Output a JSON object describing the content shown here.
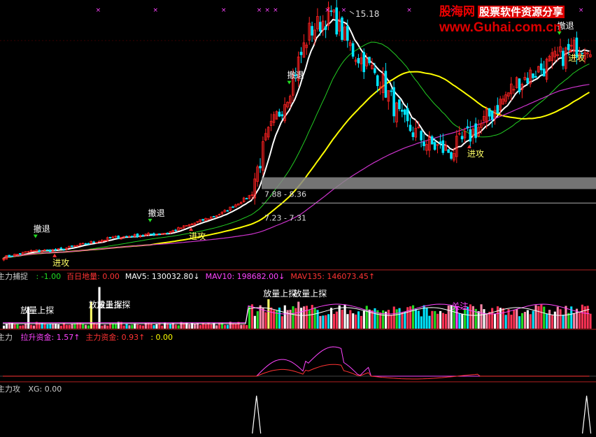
{
  "watermark": {
    "brand": "股海网",
    "slogan": "股票软件资源分享",
    "url": "www.Guhai.com.cn"
  },
  "main_pane": {
    "peak_label": "15.18",
    "range_boxes": [
      {
        "label": "7.88 - 8.36",
        "low": 7.88,
        "high": 8.36
      },
      {
        "label": "7.23 - 7.31",
        "low": 7.23,
        "high": 7.31
      }
    ],
    "signals": [
      {
        "text": "撤退",
        "index": 12
      },
      {
        "text": "进攻",
        "index": 19
      },
      {
        "text": "撤退",
        "index": 54
      },
      {
        "text": "进攻",
        "index": 69
      },
      {
        "text": "撤退",
        "index": 105
      },
      {
        "text": "进攻",
        "index": 171
      },
      {
        "text": "撤退",
        "index": 204
      },
      {
        "text": "进攻",
        "index": 208
      }
    ]
  },
  "volume_pane": {
    "title": "主力捕捉",
    "readouts": [
      {
        "text": ": -1.00",
        "color": "#22dd22"
      },
      {
        "text": "百日地量: 0.00",
        "color": "#ff3333"
      },
      {
        "text": "MAV5: 130032.80",
        "color": "#ffffff"
      },
      {
        "text": "MAV10: 198682.00",
        "color": "#ff44ff"
      },
      {
        "text": "MAV135: 146073.45",
        "color": "#ff3333"
      }
    ],
    "arrows": [
      "↓",
      "↓",
      "↑"
    ],
    "annotations": [
      {
        "text": "放量上探",
        "index": 8
      },
      {
        "text": "放量上探",
        "index": 33
      },
      {
        "text": "放量上探",
        "index": 36
      },
      {
        "text": "放量上探",
        "index": 97
      },
      {
        "text": "放量上探",
        "index": 108
      },
      {
        "text": "关注",
        "index": 166
      }
    ]
  },
  "fund_pane": {
    "title": "主力",
    "readouts": [
      {
        "text": "拉升资金: 1.57",
        "color": "#ff44ff",
        "arrow": "↑"
      },
      {
        "text": "主力资金: 0.93",
        "color": "#ff3333",
        "arrow": "↑"
      },
      {
        "text": ": 0.00",
        "color": "#ffff00",
        "arrow": ""
      }
    ]
  },
  "attack_pane": {
    "title": "主力攻",
    "readouts": [
      {
        "text": "XG: 0.00",
        "color": "#cccccc"
      }
    ]
  },
  "chart_data": {
    "type": "candlestick",
    "series_colors": {
      "up_candle": "#ff2222",
      "down_candle": "#00e5ff",
      "ma_white": "#ffffff",
      "ma_green": "#22cc22",
      "ma_yellow": "#ffff00",
      "ma_magenta": "#cc33cc"
    },
    "price_anchors": [
      [
        0,
        5.1
      ],
      [
        10,
        5.35
      ],
      [
        20,
        5.4
      ],
      [
        40,
        5.9
      ],
      [
        60,
        6.1
      ],
      [
        80,
        6.9
      ],
      [
        90,
        7.6
      ],
      [
        96,
        9.8
      ],
      [
        104,
        11.8
      ],
      [
        112,
        14.3
      ],
      [
        120,
        15.0
      ],
      [
        128,
        13.5
      ],
      [
        138,
        12.4
      ],
      [
        146,
        10.6
      ],
      [
        156,
        9.7
      ],
      [
        164,
        9.4
      ],
      [
        176,
        10.6
      ],
      [
        188,
        12.2
      ],
      [
        200,
        13.0
      ],
      [
        212,
        13.8
      ]
    ],
    "volume_spikes": [
      {
        "index": 9,
        "value": 0.45,
        "color": "#ffffff"
      },
      {
        "index": 32,
        "value": 0.55,
        "color": "#ffff66"
      },
      {
        "index": 35,
        "value": 0.85,
        "color": "#ffffff"
      },
      {
        "index": 97,
        "value": 0.6,
        "color": "#ffff66"
      },
      {
        "index": 108,
        "value": 0.55,
        "color": "#ff88aa"
      },
      {
        "index": 166,
        "value": 0.45,
        "color": "#ff44ff"
      }
    ],
    "xg_peaks": [
      {
        "index": 93,
        "value": 1
      },
      {
        "index": 214,
        "value": 1
      }
    ]
  }
}
